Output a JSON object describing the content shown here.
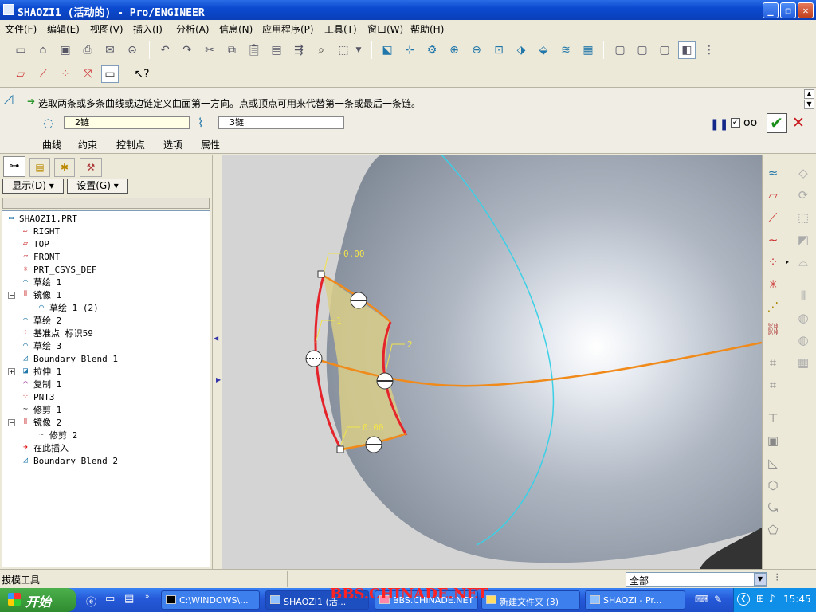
{
  "window": {
    "title": "SHAOZI1 (活动的) - Pro/ENGINEER"
  },
  "menu": [
    "文件(F)",
    "编辑(E)",
    "视图(V)",
    "插入(I)",
    "分析(A)",
    "信息(N)",
    "应用程序(P)",
    "工具(T)",
    "窗口(W)",
    "帮助(H)"
  ],
  "dashboard": {
    "prompt": "选取两条或多条曲线或边链定义曲面第一方向。点或顶点可用来代替第一条或最后一条链。",
    "first_direction": "2链",
    "second_direction": "3链",
    "tabs": [
      "曲线",
      "约束",
      "控制点",
      "选项",
      "属性"
    ]
  },
  "navigator": {
    "show_button": "显示(D)",
    "settings_button": "设置(G)",
    "tree": [
      {
        "label": "SHAOZI1.PRT",
        "icon": "part-icon"
      },
      {
        "label": "RIGHT",
        "icon": "datum-plane-icon"
      },
      {
        "label": "TOP",
        "icon": "datum-plane-icon"
      },
      {
        "label": "FRONT",
        "icon": "datum-plane-icon"
      },
      {
        "label": "PRT_CSYS_DEF",
        "icon": "csys-icon"
      },
      {
        "label": "草绘 1",
        "icon": "sketch-icon"
      },
      {
        "label": "镜像 1",
        "icon": "mirror-icon"
      },
      {
        "label": "草绘 1 (2)",
        "icon": "sketch-icon"
      },
      {
        "label": "草绘 2",
        "icon": "sketch-icon"
      },
      {
        "label": "基准点 标识59",
        "icon": "datum-point-icon"
      },
      {
        "label": "草绘 3",
        "icon": "sketch-icon"
      },
      {
        "label": "Boundary Blend 1",
        "icon": "boundary-blend-icon"
      },
      {
        "label": "拉伸 1",
        "icon": "extrude-icon"
      },
      {
        "label": "复制 1",
        "icon": "copy-icon"
      },
      {
        "label": "PNT3",
        "icon": "datum-point-icon"
      },
      {
        "label": "修剪 1",
        "icon": "trim-icon"
      },
      {
        "label": "镜像 2",
        "icon": "mirror-icon"
      },
      {
        "label": "修剪 2",
        "icon": "trim-icon"
      },
      {
        "label": "在此插入",
        "icon": "insert-here-icon"
      },
      {
        "label": "Boundary Blend 2",
        "icon": "boundary-blend-icon"
      }
    ]
  },
  "viewport": {
    "label_top": "0.00",
    "label_bottom": "0.00",
    "label_left": "1",
    "label_right": "2"
  },
  "status": {
    "message": "拔模工具",
    "filter": "全部"
  },
  "taskbar": {
    "start": "开始",
    "tasks": [
      "C:\\WINDOWS\\...",
      "SHAOZI1 (活...",
      "BBS.CHINADE.NET",
      "新建文件夹 (3)",
      "SHAOZI - Pr..."
    ],
    "clock": "15:45"
  },
  "watermark": "BBS.CHINADE.NET"
}
